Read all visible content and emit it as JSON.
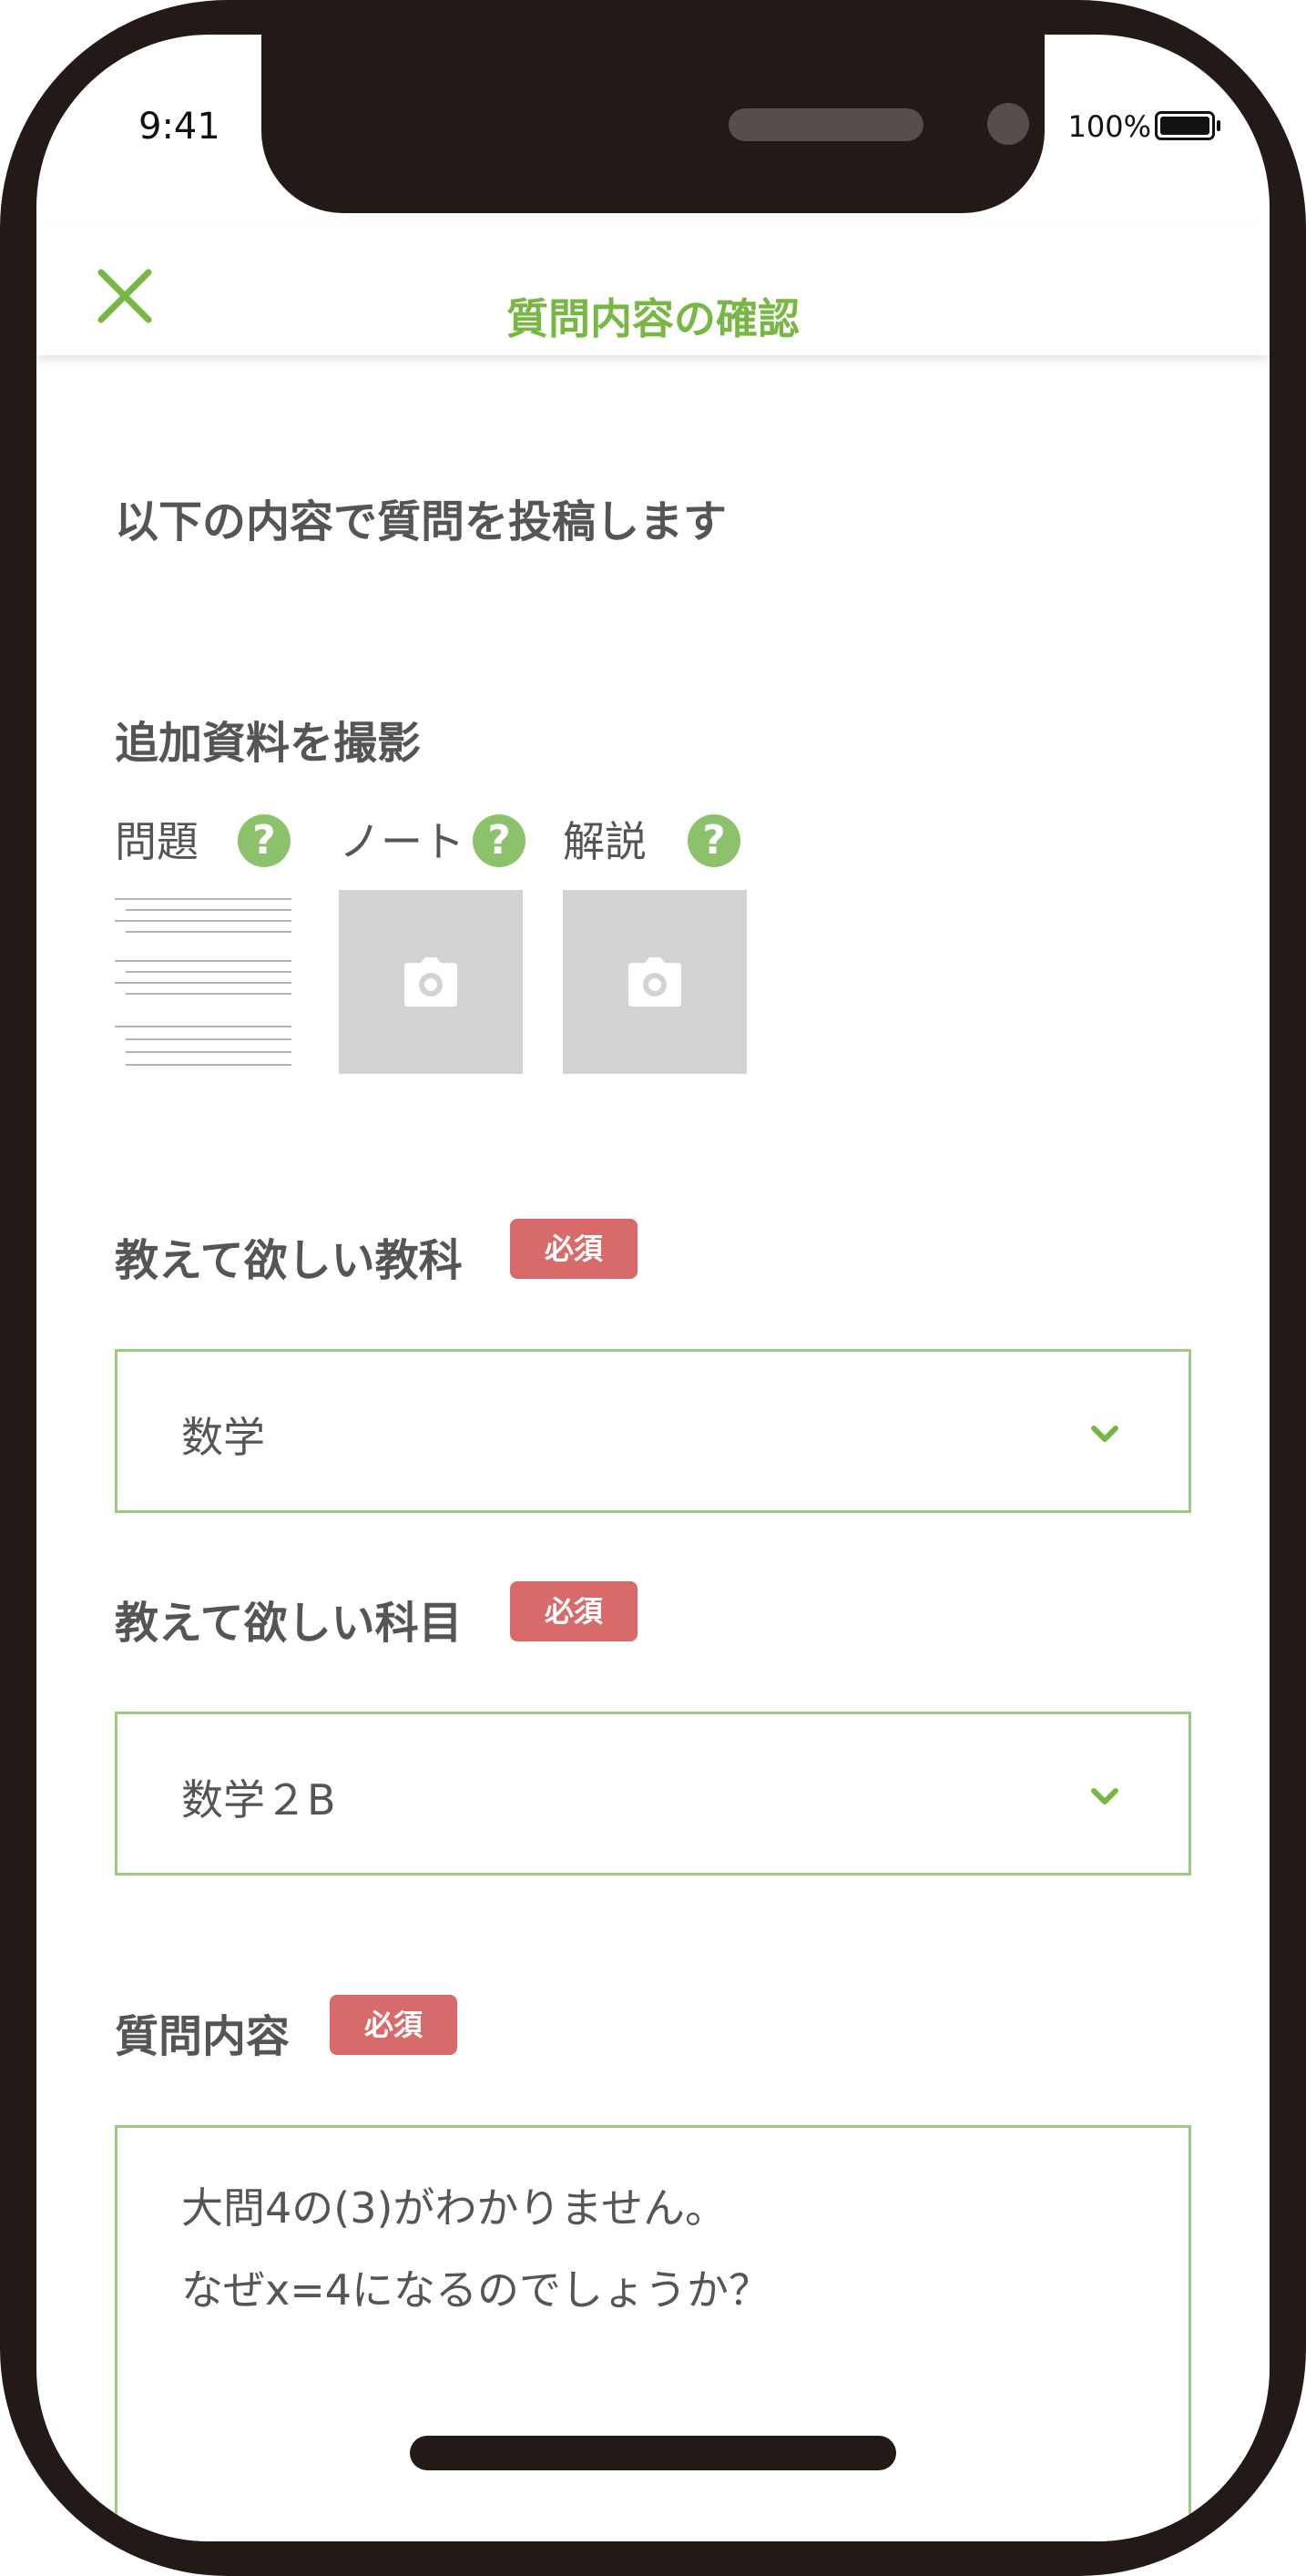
{
  "status_bar": {
    "time": "9:41",
    "battery": "100%"
  },
  "header": {
    "title": "質問内容の確認",
    "close_icon": "close-icon",
    "accent": "#78b744"
  },
  "lead": "以下の内容で質問を投稿します",
  "attachments": {
    "title": "追加資料を撮影",
    "items": [
      {
        "label": "問題"
      },
      {
        "label": "ノート"
      },
      {
        "label": "解説"
      }
    ],
    "help_icon": "question-icon",
    "camera_icon": "camera-icon"
  },
  "required_label": "必須",
  "subject": {
    "label": "教えて欲しい教科",
    "value": "数学"
  },
  "course": {
    "label": "教えて欲しい科目",
    "value": "数学２B"
  },
  "question": {
    "label": "質問内容",
    "lines": [
      "大問4の(3)がわかりません。",
      "なぜx=4になるのでしょうか？"
    ]
  },
  "colors": {
    "required_bg": "#d96a6a",
    "field_border": "#9bca80",
    "help_bg": "#8bc26b"
  }
}
